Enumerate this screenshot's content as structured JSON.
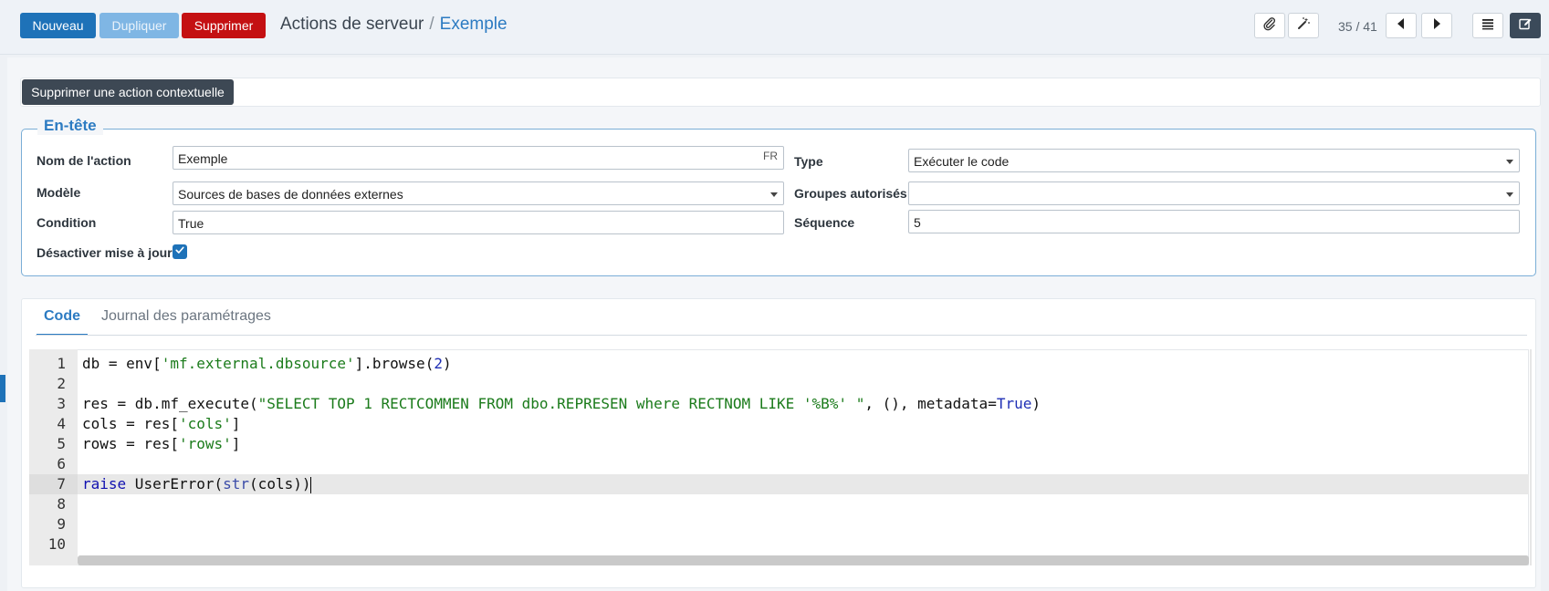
{
  "control_panel": {
    "new_label": "Nouveau",
    "duplicate_label": "Dupliquer",
    "delete_label": "Supprimer",
    "breadcrumb_parent": "Actions de serveur",
    "breadcrumb_separator": "/",
    "breadcrumb_current": "Exemple",
    "pager": "35 / 41"
  },
  "action_bar": {
    "contextual_button": "Supprimer une action contextuelle"
  },
  "header_group": {
    "title": "En-tête",
    "fields": {
      "action_name_label": "Nom de l'action",
      "action_name_value": "Exemple",
      "action_name_lang": "FR",
      "model_label": "Modèle",
      "model_value": "Sources de bases de données externes",
      "condition_label": "Condition",
      "condition_value": "True",
      "disable_update_label": "Désactiver mise à jour",
      "disable_update_checked": true,
      "type_label": "Type",
      "type_value": "Exécuter le code",
      "groups_label": "Groupes autorisés",
      "groups_value": "",
      "sequence_label": "Séquence",
      "sequence_value": "5"
    }
  },
  "tabs": [
    "Code",
    "Journal des paramétrages"
  ],
  "code_editor": {
    "line_numbers": [
      "1",
      "2",
      "3",
      "4",
      "5",
      "6",
      "7",
      "8",
      "9",
      "10"
    ],
    "lines": [
      "db = env['mf.external.dbsource'].browse(2)",
      "",
      "res = db.mf_execute(\"SELECT TOP 1 RECTCOMMEN FROM dbo.REPRESEN where RECTNOM LIKE '%B%' \", (), metadata=True)",
      "cols = res['cols']",
      "rows = res['rows']",
      "",
      "raise UserError(str(cols))",
      "",
      "",
      ""
    ],
    "active_line": "7"
  },
  "icons": [
    "paperclip-icon",
    "magic-wand-icon",
    "caret-left-icon",
    "caret-right-icon",
    "list-view-icon",
    "form-view-icon",
    "checkmark-icon"
  ],
  "colors": {
    "primary": "#1e72b8",
    "danger": "#c41012",
    "link": "#2c7bc2"
  }
}
